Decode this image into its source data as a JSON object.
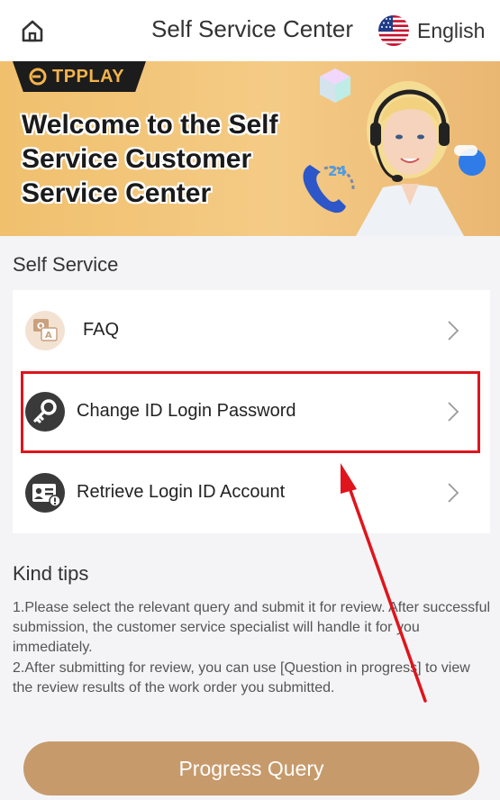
{
  "header": {
    "title": "Self Service Center",
    "language": "English",
    "home_icon": "home-icon",
    "flag_icon": "us-flag-icon"
  },
  "banner": {
    "logo_text": "TPPLAY",
    "welcome_text": "Welcome to the Self Service Customer Service Center",
    "badge_number": "24"
  },
  "self_service": {
    "title": "Self Service",
    "items": [
      {
        "label": "FAQ",
        "icon": "faq-qa-icon"
      },
      {
        "label": "Change ID Login Password",
        "icon": "key-icon"
      },
      {
        "label": "Retrieve Login ID Account",
        "icon": "id-card-icon"
      }
    ]
  },
  "tips": {
    "title": "Kind tips",
    "items": [
      "1.Please select the relevant query and submit it for review. After successful submission, the customer service specialist will handle it for you immediately.",
      "2.After submitting for review, you can use [Question in progress] to view the review results of the work order you submitted."
    ]
  },
  "footer": {
    "progress_button": "Progress Query"
  },
  "colors": {
    "accent": "#c79a6c",
    "highlight": "#e0141c",
    "banner": "#f0c06d"
  }
}
